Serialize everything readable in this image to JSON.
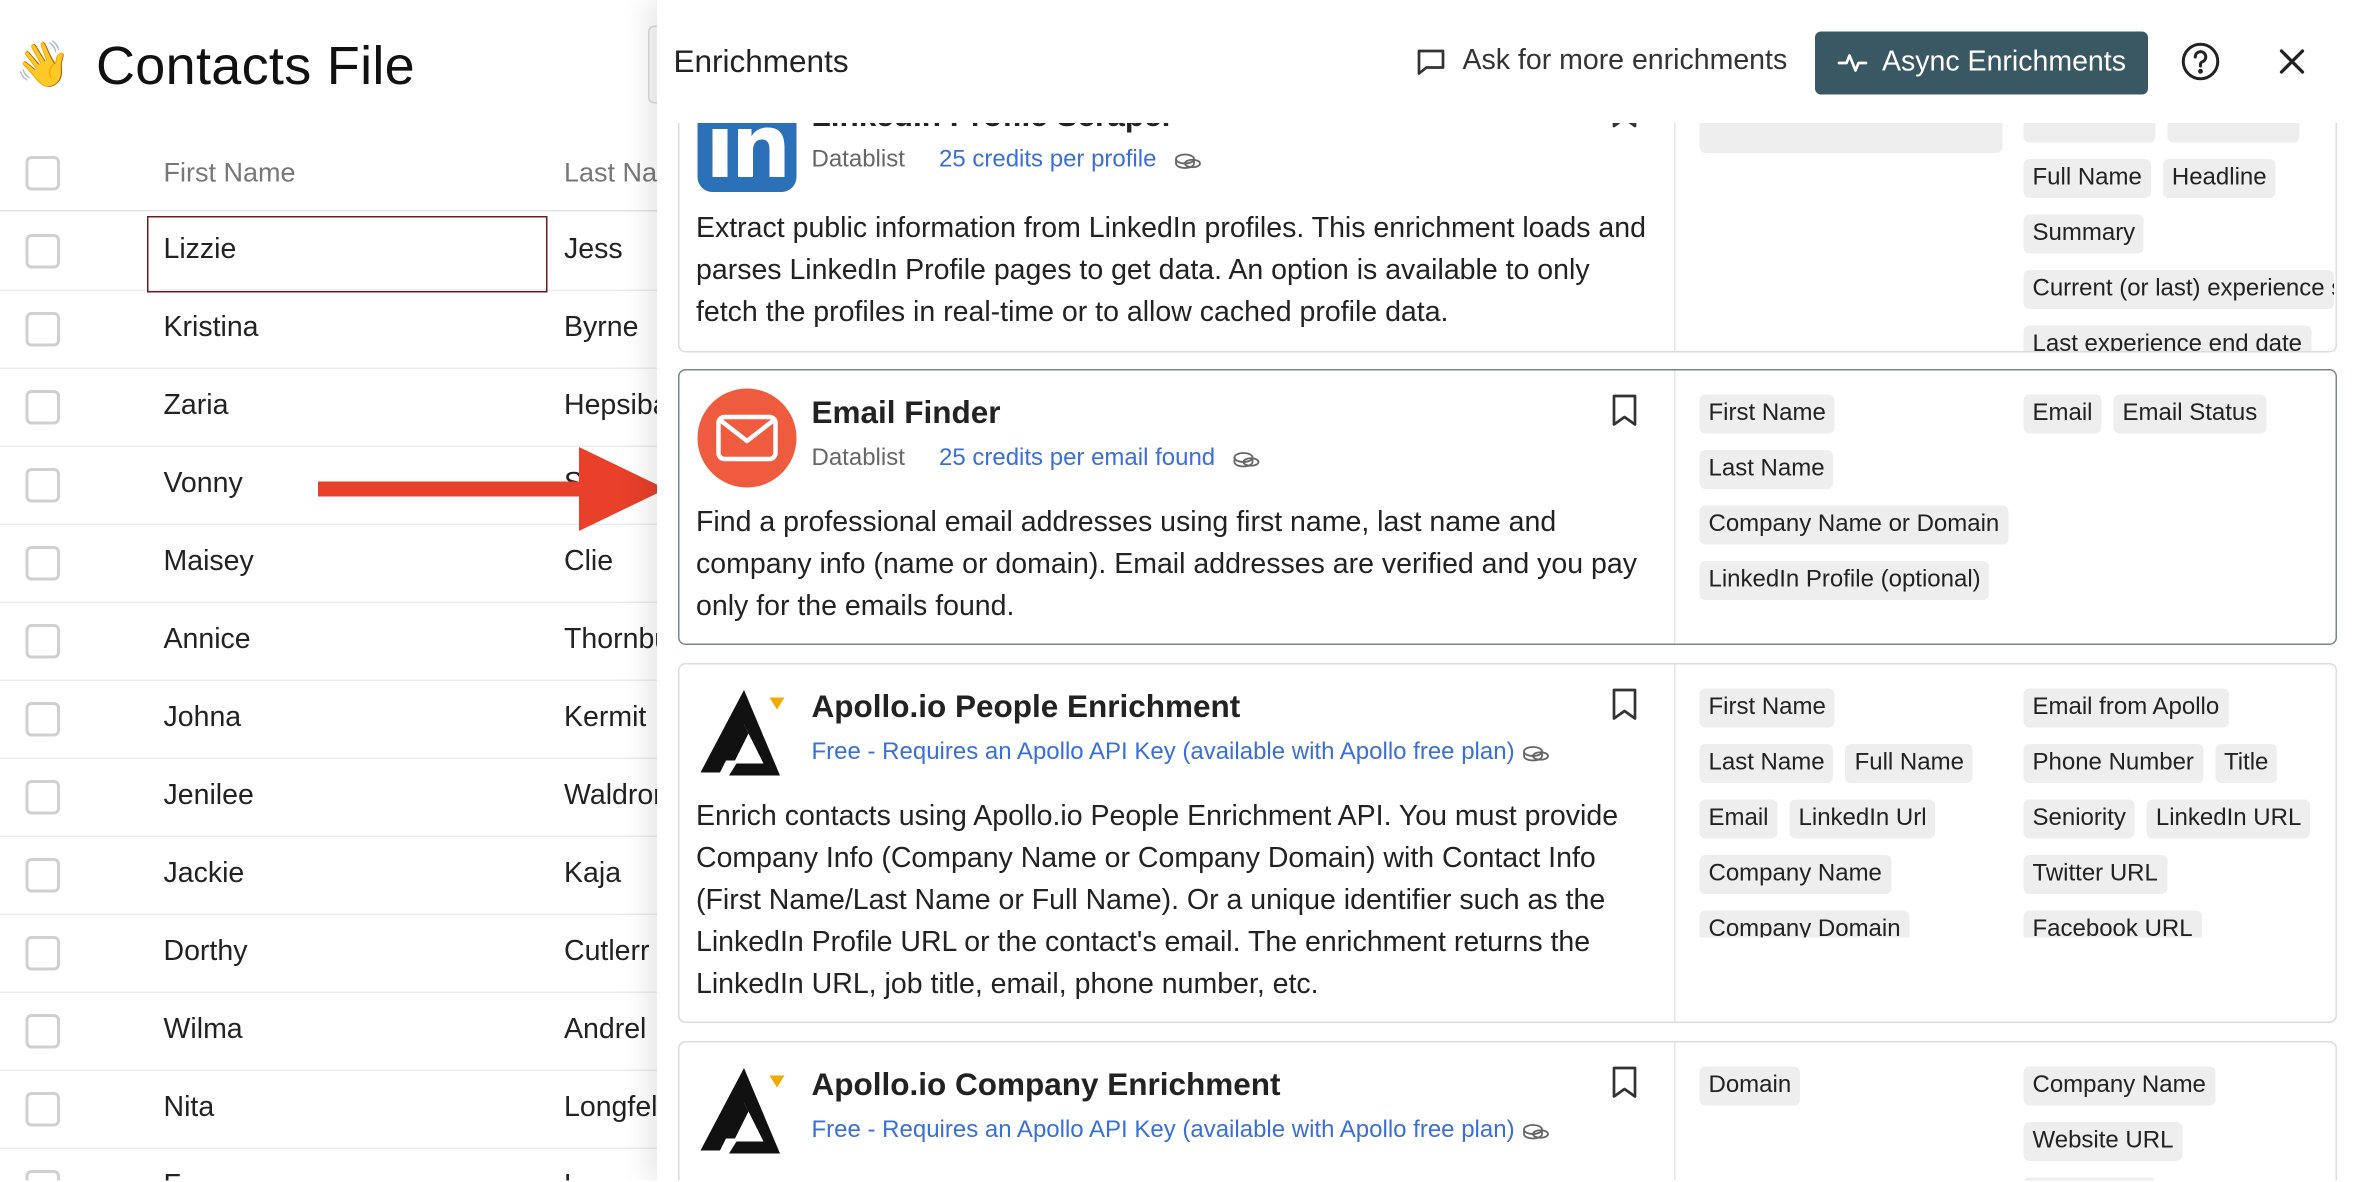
{
  "page": {
    "title": "Contacts File",
    "title_emoji": "👋"
  },
  "table": {
    "columns": [
      "First Name",
      "Last Na"
    ],
    "rows": [
      {
        "first": "Lizzie",
        "last": "Jess"
      },
      {
        "first": "Kristina",
        "last": "Byrne"
      },
      {
        "first": "Zaria",
        "last": "Hepsiba"
      },
      {
        "first": "Vonny",
        "last": "S"
      },
      {
        "first": "Maisey",
        "last": "Clie"
      },
      {
        "first": "Annice",
        "last": "Thornbu"
      },
      {
        "first": "Johna",
        "last": "Kermit"
      },
      {
        "first": "Jenilee",
        "last": "Waldror"
      },
      {
        "first": "Jackie",
        "last": "Kaja"
      },
      {
        "first": "Dorthy",
        "last": "Cutlerr"
      },
      {
        "first": "Wilma",
        "last": "Andrel"
      },
      {
        "first": "Nita",
        "last": "Longfel"
      },
      {
        "first": "F",
        "last": "L"
      }
    ]
  },
  "panel": {
    "title": "Enrichments",
    "ask_label": "Ask for more enrichments",
    "async_label": "Async Enrichments",
    "cards": [
      {
        "name": "LinkedIn Profile Scraper",
        "provider": "Datablist",
        "credits": "25 credits per profile",
        "logo": "linkedin-logo",
        "description": "Extract public information from LinkedIn profiles. This enrichment loads and parses LinkedIn Profile pages to get data. An option is available to only fetch the profiles in real-time or to allow cached profile data.",
        "inputs": [
          ""
        ],
        "outputs": [
          "",
          "",
          "Full Name",
          "Headline",
          "Summary",
          "Current (or last) experience s",
          "Last experience end date"
        ]
      },
      {
        "name": "Email Finder",
        "provider": "Datablist",
        "credits": "25 credits per email found",
        "logo": "email-logo",
        "description": "Find a professional email addresses using first name, last name and company info (name or domain). Email addresses are verified and you pay only for the emails found.",
        "inputs": [
          "First Name",
          "Last Name",
          "Company Name or Domain",
          "LinkedIn Profile (optional)"
        ],
        "outputs": [
          "Email",
          "Email Status"
        ]
      },
      {
        "name": "Apollo.io People Enrichment",
        "provider": "",
        "credits": "Free - Requires an Apollo API Key (available with Apollo free plan)",
        "logo": "apollo-logo",
        "description": "Enrich contacts using Apollo.io People Enrichment API. You must provide Company Info (Company Name or Company Domain) with Contact Info (First Name/Last Name or Full Name). Or a unique identifier such as the LinkedIn Profile URL or the contact's email. The enrichment returns the LinkedIn URL, job title, email, phone number, etc.",
        "inputs": [
          "First Name",
          "Last Name",
          "Full Name",
          "Email",
          "LinkedIn Url",
          "Company Name",
          "Company Domain"
        ],
        "outputs": [
          "Email from Apollo",
          "Phone Number",
          "Title",
          "Seniority",
          "LinkedIn URL",
          "Twitter URL",
          "Facebook URL"
        ]
      },
      {
        "name": "Apollo.io Company Enrichment",
        "provider": "",
        "credits": "Free - Requires an Apollo API Key (available with Apollo free plan)",
        "logo": "apollo-logo",
        "description": "",
        "inputs": [
          "Domain"
        ],
        "outputs": [
          "Company Name",
          "Website URL",
          ""
        ]
      }
    ]
  },
  "colors": {
    "accent_button": "#3a5863",
    "link_blue": "#3a6fd8",
    "arrow_red": "#e8402a",
    "email_logo": "#ef5b3f",
    "linkedin_blue": "#2c71b8"
  }
}
